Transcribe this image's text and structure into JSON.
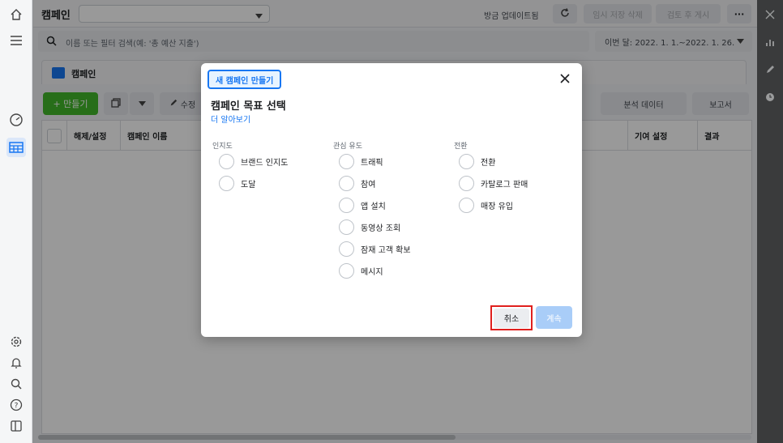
{
  "topbar": {
    "title": "캠페인",
    "updated_text": "방금 업데이트됨",
    "discard_draft": "임시 저장 삭제",
    "review_publish": "검토 후 게시",
    "more": "···"
  },
  "search": {
    "placeholder": "이름 또는 필터 검색(예: '총 예산 지출')",
    "date_range": "이번 달: 2022. 1. 1.~2022. 1. 26."
  },
  "panel": {
    "title": "캠페인",
    "create_label": "+ 만들기",
    "edit_label": "수정",
    "breakdown_label": "분석 데이터",
    "reports_label": "보고서"
  },
  "grid": {
    "columns": [
      "해제/설정",
      "캠페인 이름",
      "기여 설정",
      "결과"
    ]
  },
  "modal": {
    "tag": "새 캠페인 만들기",
    "title": "캠페인 목표 선택",
    "learn_more": "더 알아보기",
    "groups": [
      {
        "heading": "인지도",
        "options": [
          "브랜드 인지도",
          "도달"
        ]
      },
      {
        "heading": "관심 유도",
        "options": [
          "트래픽",
          "참여",
          "앱 설치",
          "동영상 조회",
          "잠재 고객 확보",
          "메시지"
        ]
      },
      {
        "heading": "전환",
        "options": [
          "전환",
          "카탈로그 판매",
          "매장 유입"
        ]
      }
    ],
    "cancel": "취소",
    "continue": "계속"
  },
  "colors": {
    "accent": "#1877f2",
    "create_green": "#42b72a",
    "highlight_red": "#e0201e",
    "disabled_blue": "#a9cdf8"
  },
  "icons": [
    "home-icon",
    "menu-icon",
    "dashboard-icon",
    "table-grid-icon",
    "settings-icon",
    "bell-icon",
    "search-icon",
    "help-icon",
    "panel-toggle-icon",
    "close-icon",
    "chart-icon",
    "pencil-icon",
    "clock-icon",
    "refresh-icon",
    "chevron-down-icon",
    "folder-icon",
    "copy-icon"
  ]
}
